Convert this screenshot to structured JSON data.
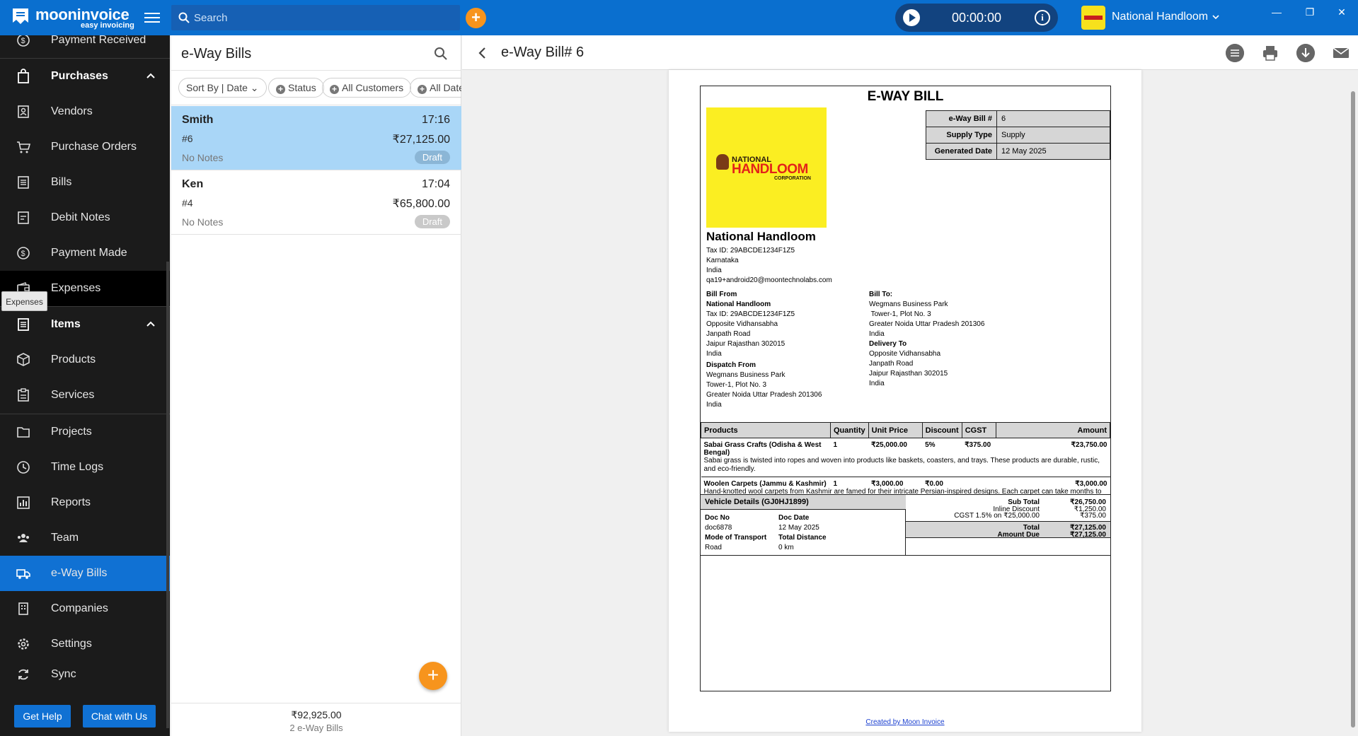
{
  "app": {
    "brand": "mooninvoice",
    "tagline": "easy invoicing",
    "search_placeholder": "Search",
    "timer": "00:00:00",
    "company": "National Handloom",
    "accent_color": "#0a6fcf",
    "window_controls": [
      "—",
      "❐",
      "✕"
    ]
  },
  "sidebar": {
    "payment_received": "Payment Received",
    "purchases": "Purchases",
    "vendors": "Vendors",
    "purchase_orders": "Purchase Orders",
    "bills": "Bills",
    "debit_notes": "Debit Notes",
    "payment_made": "Payment Made",
    "expenses": "Expenses",
    "items": "Items",
    "products": "Products",
    "services": "Services",
    "projects": "Projects",
    "time_logs": "Time Logs",
    "reports": "Reports",
    "team": "Team",
    "eway_bills": "e-Way Bills",
    "companies": "Companies",
    "settings": "Settings",
    "sync": "Sync",
    "tooltip": "Expenses",
    "get_help": "Get Help",
    "chat": "Chat with Us"
  },
  "list": {
    "title": "e-Way Bills",
    "filters": [
      "Sort By | Date",
      "Status",
      "All Customers",
      "All Dates"
    ],
    "rows": [
      {
        "name": "Smith",
        "time": "17:16",
        "number": "#6",
        "amount": "₹27,125.00",
        "notes": "No Notes",
        "status": "Draft"
      },
      {
        "name": "Ken",
        "time": "17:04",
        "number": "#4",
        "amount": "₹65,800.00",
        "notes": "No Notes",
        "status": "Draft"
      }
    ],
    "total": "₹92,925.00",
    "count": "2 e-Way Bills"
  },
  "detail": {
    "title": "e-Way Bill# 6"
  },
  "document": {
    "heading": "E-WAY BILL",
    "logo": {
      "line1": "NATIONAL",
      "line2": "HANDLOOM",
      "line3": "CORPORATION"
    },
    "meta": [
      {
        "k": "e-Way Bill #",
        "v": "6"
      },
      {
        "k": "Supply Type",
        "v": "Supply"
      },
      {
        "k": "Generated Date",
        "v": "12 May 2025"
      }
    ],
    "company": {
      "name": "National Handloom",
      "lines": [
        "Tax ID: 29ABCDE1234F1Z5",
        "Karnataka",
        "India",
        "qa19+android20@moontechnolabs.com"
      ]
    },
    "bill_from": {
      "label": "Bill From",
      "name": "National Handloom",
      "lines": [
        "Tax ID: 29ABCDE1234F1Z5",
        "Opposite Vidhansabha",
        "Janpath Road",
        "Jaipur Rajasthan 302015",
        "India"
      ]
    },
    "dispatch_from": {
      "label": "Dispatch From",
      "lines": [
        "Wegmans Business Park",
        "Tower-1, Plot No. 3",
        "Greater Noida Uttar Pradesh 201306",
        "India"
      ]
    },
    "bill_to": {
      "label": "Bill To:",
      "lines": [
        "Wegmans Business Park",
        " Tower-1, Plot No. 3",
        "Greater Noida Uttar Pradesh 201306",
        "India"
      ]
    },
    "delivery_to": {
      "label": "Delivery To",
      "lines": [
        "Opposite Vidhansabha",
        "Janpath Road",
        "Jaipur Rajasthan 302015",
        "India"
      ]
    },
    "columns": [
      "Products",
      "Quantity",
      "Unit Price",
      "Discount",
      "CGST",
      "Amount"
    ],
    "items": [
      {
        "name": "Sabai Grass Crafts (Odisha & West Bengal)",
        "qty": "1",
        "price": "₹25,000.00",
        "discount": "5%",
        "cgst": "₹375.00",
        "amount": "₹23,750.00",
        "desc": "Sabai grass is twisted into ropes and woven into products like baskets, coasters, and trays. These products are durable, rustic, and eco-friendly."
      },
      {
        "name": "Woolen Carpets (Jammu & Kashmir)",
        "qty": "1",
        "price": "₹3,000.00",
        "discount": "₹0.00",
        "cgst": "",
        "amount": "₹3,000.00",
        "desc": "Hand-knotted wool carpets from Kashmir are famed for their intricate Persian-inspired designs. Each carpet can take months to finish and is a heritage craft passed down through generations."
      }
    ],
    "vehicle": {
      "heading": "Vehicle Details (GJ0HJ1899)",
      "doc_no_label": "Doc No",
      "doc_no": "doc6878",
      "doc_date_label": "Doc Date",
      "doc_date": "12 May 2025",
      "transport_label": "Mode of Transport",
      "transport": "Road",
      "distance_label": "Total Distance",
      "distance": "0 km"
    },
    "totals": {
      "sub_total_label": "Sub Total",
      "sub_total": "₹26,750.00",
      "inline_discount_label": "Inline Discount",
      "inline_discount": "₹1,250.00",
      "cgst_label": "CGST 1.5% on ₹25,000.00",
      "cgst": "₹375.00",
      "total_label": "Total",
      "total": "₹27,125.00",
      "due_label": "Amount Due",
      "due": "₹27,125.00"
    },
    "footer": "Created by Moon Invoice"
  }
}
